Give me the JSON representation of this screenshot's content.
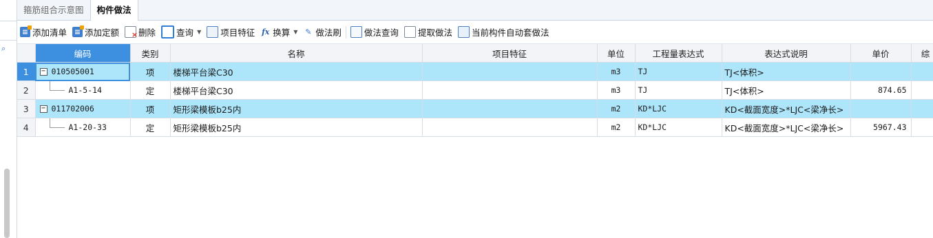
{
  "tabs": [
    {
      "label": "箍筋组合示意图",
      "active": false
    },
    {
      "label": "构件做法",
      "active": true
    }
  ],
  "toolbar": {
    "add_list": "添加清单",
    "add_quota": "添加定额",
    "delete": "删除",
    "query": "查询",
    "item_feature": "项目特征",
    "convert": "换算",
    "method_brush": "做法刷",
    "method_query": "做法查询",
    "extract_method": "提取做法",
    "auto_method": "当前构件自动套做法"
  },
  "table": {
    "headers": [
      "编码",
      "类别",
      "名称",
      "项目特征",
      "单位",
      "工程量表达式",
      "表达式说明",
      "单价",
      "综"
    ],
    "rows": [
      {
        "no": "1",
        "code": "010505001",
        "type": "项",
        "name": "楼梯平台梁C30",
        "feature": "",
        "unit": "m3",
        "expr": "TJ",
        "expr_desc": "TJ<体积>",
        "price": "",
        "kind": "parent"
      },
      {
        "no": "2",
        "code": "A1-5-14",
        "type": "定",
        "name": "楼梯平台梁C30",
        "feature": "",
        "unit": "m3",
        "expr": "TJ",
        "expr_desc": "TJ<体积>",
        "price": "874.65",
        "kind": "child"
      },
      {
        "no": "3",
        "code": "011702006",
        "type": "项",
        "name": "矩形梁模板b25内",
        "feature": "",
        "unit": "m2",
        "expr": "KD*LJC",
        "expr_desc": "KD<截面宽度>*LJC<梁净长>",
        "price": "",
        "kind": "parent"
      },
      {
        "no": "4",
        "code": "A1-20-33",
        "type": "定",
        "name": "矩形梁模板b25内",
        "feature": "",
        "unit": "m2",
        "expr": "KD*LJC",
        "expr_desc": "KD<截面宽度>*LJC<梁净长>",
        "price": "5967.43",
        "kind": "child"
      }
    ]
  },
  "colors": {
    "selected_row": "#ade5fa",
    "header_selected": "#3d8fe0"
  }
}
